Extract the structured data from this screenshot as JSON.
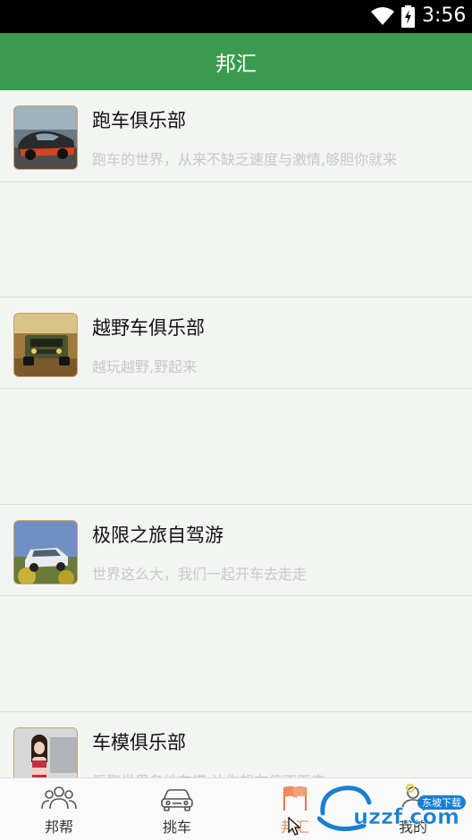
{
  "status_bar": {
    "time": "3:56",
    "wifi_icon": "wifi-icon",
    "battery_icon": "battery-charging-icon"
  },
  "app_bar": {
    "title": "邦汇"
  },
  "clubs": [
    {
      "name": "跑车俱乐部",
      "desc": "跑车的世界，从来不缺乏速度与激情,够胆你就来",
      "thumb": "sports-car-photo"
    },
    {
      "name": "越野车俱乐部",
      "desc": "越玩越野,野起来",
      "thumb": "offroad-jeep-photo"
    },
    {
      "name": "极限之旅自驾游",
      "desc": "世界这么大，我们一起开车去走走",
      "thumb": "suv-travel-photo"
    },
    {
      "name": "车模俱乐部",
      "desc": "汇聚世界各地车模,让你想在停不下来",
      "thumb": "car-model-photo"
    }
  ],
  "tabs": [
    {
      "label": "邦帮",
      "icon": "people-group-icon"
    },
    {
      "label": "挑车",
      "icon": "car-icon"
    },
    {
      "label": "邦汇",
      "icon": "flags-icon",
      "active": true
    },
    {
      "label": "我的",
      "icon": "person-icon"
    }
  ],
  "watermark": {
    "text": "uzzf.com",
    "subtext": "东坡下载"
  },
  "colors": {
    "primary": "#3a9a4f",
    "active_tab": "#f08a5a",
    "background": "#f2f5f2"
  }
}
